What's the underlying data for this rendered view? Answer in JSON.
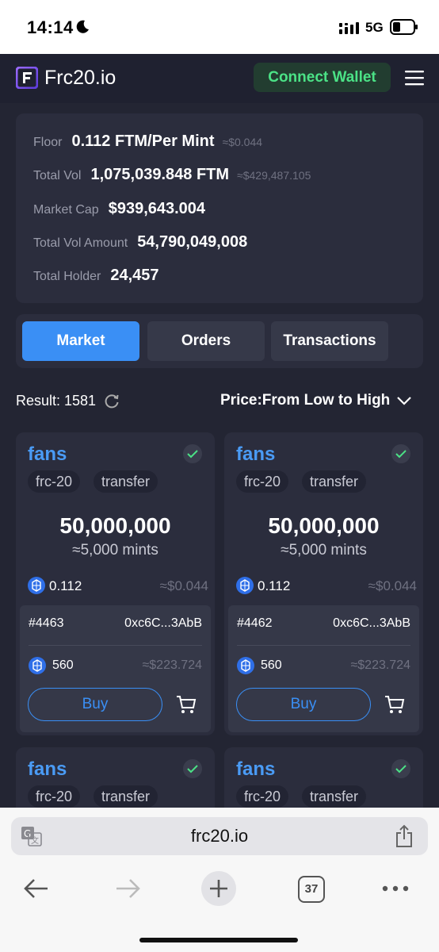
{
  "status_bar": {
    "time": "14:14",
    "network": "5G"
  },
  "nav": {
    "logo": "Frc20.io",
    "connect_label": "Connect Wallet"
  },
  "stats": {
    "floor_label": "Floor",
    "floor_value": "0.112 FTM/Per Mint",
    "floor_approx": "≈$0.044",
    "vol_label": "Total Vol",
    "vol_value": "1,075,039.848 FTM",
    "vol_approx": "≈$429,487.105",
    "cap_label": "Market Cap",
    "cap_value": "$939,643.004",
    "amount_label": "Total Vol Amount",
    "amount_value": "54,790,049,008",
    "holder_label": "Total Holder",
    "holder_value": "24,457"
  },
  "tabs": [
    {
      "label": "Market",
      "active": true
    },
    {
      "label": "Orders",
      "active": false
    },
    {
      "label": "Transactions",
      "active": false
    }
  ],
  "list": {
    "result_label": "Result: 1581",
    "sort_label": "Price:From Low to High"
  },
  "cards": [
    {
      "ticker": "fans",
      "chip1": "frc-20",
      "chip2": "transfer",
      "amount": "50,000,000",
      "mints": "≈5,000 mints",
      "price": "0.112",
      "price_usd": "≈$0.044",
      "id": "#4463",
      "address": "0xc6C...3AbB",
      "total": "560",
      "total_usd": "≈$223.724",
      "buy_label": "Buy"
    },
    {
      "ticker": "fans",
      "chip1": "frc-20",
      "chip2": "transfer",
      "amount": "50,000,000",
      "mints": "≈5,000 mints",
      "price": "0.112",
      "price_usd": "≈$0.044",
      "id": "#4462",
      "address": "0xc6C...3AbB",
      "total": "560",
      "total_usd": "≈$223.724",
      "buy_label": "Buy"
    },
    {
      "ticker": "fans",
      "chip1": "frc-20",
      "chip2": "transfer"
    },
    {
      "ticker": "fans",
      "chip1": "frc-20",
      "chip2": "transfer"
    }
  ],
  "browser": {
    "url": "frc20.io",
    "tab_count": "37"
  },
  "colors": {
    "accent": "#3a8ff5",
    "connect_text": "#4be286",
    "background": "#232533",
    "card": "#2b2d3d"
  }
}
